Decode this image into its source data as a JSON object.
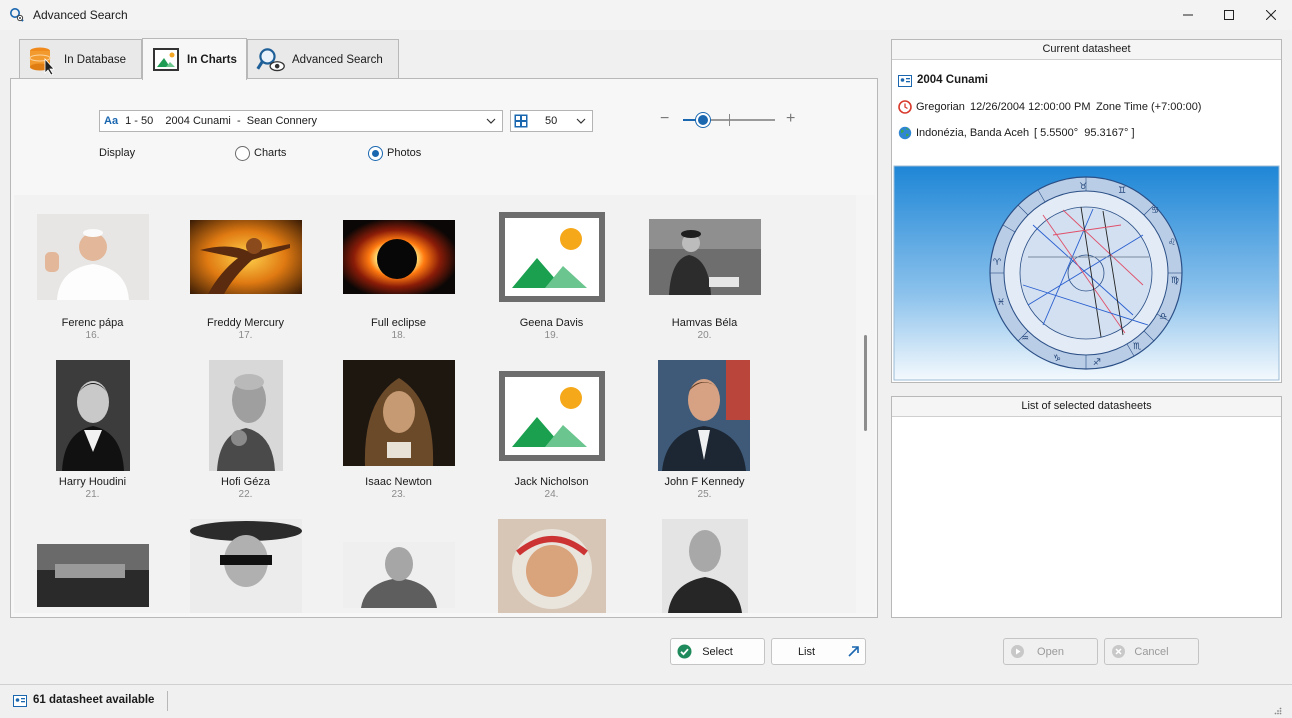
{
  "window": {
    "title": "Advanced Search"
  },
  "tabs": [
    {
      "label": "In Database",
      "icon": "database-cursor-icon"
    },
    {
      "label": "In Charts",
      "icon": "chart-image-icon"
    },
    {
      "label": "Advanced Search",
      "icon": "magnifier-eye-icon"
    }
  ],
  "toolbar": {
    "selection_prefix": "Aa",
    "selection_value": "1 - 50    2004 Cunami  -  Sean Connery",
    "page_size": "50",
    "display_label": "Display",
    "option_charts": "Charts",
    "option_photos": "Photos",
    "zoom_minus": "−",
    "zoom_plus": "+",
    "zoom_level": 0.2
  },
  "gallery": {
    "items": [
      {
        "name": "Ferenc pápa",
        "num": "16."
      },
      {
        "name": "Freddy Mercury",
        "num": "17."
      },
      {
        "name": "Full eclipse",
        "num": "18."
      },
      {
        "name": "Geena Davis",
        "num": "19."
      },
      {
        "name": "Hamvas Béla",
        "num": "20."
      },
      {
        "name": "Harry Houdini",
        "num": "21."
      },
      {
        "name": "Hofi Géza",
        "num": "22."
      },
      {
        "name": "Isaac Newton",
        "num": "23."
      },
      {
        "name": "Jack Nicholson",
        "num": "24."
      },
      {
        "name": "John F Kennedy",
        "num": "25."
      }
    ]
  },
  "current": {
    "header": "Current datasheet",
    "name": "2004 Cunami",
    "calendar": "Gregorian",
    "datetime": "12/26/2004 12:00:00 PM",
    "zone": "Zone Time (+7:00:00)",
    "place": "Indonézia, Banda Aceh",
    "coords": "[ 5.5500°  95.3167° ]"
  },
  "selected_list": {
    "header": "List of selected datasheets"
  },
  "buttons": {
    "select": "Select",
    "list": "List",
    "open": "Open",
    "cancel": "Cancel"
  },
  "status": {
    "text": "61 datasheet available"
  },
  "colors": {
    "accent": "#1a67b0",
    "check_green": "#1f8a5b",
    "chart_sky": "#1e86d6"
  }
}
